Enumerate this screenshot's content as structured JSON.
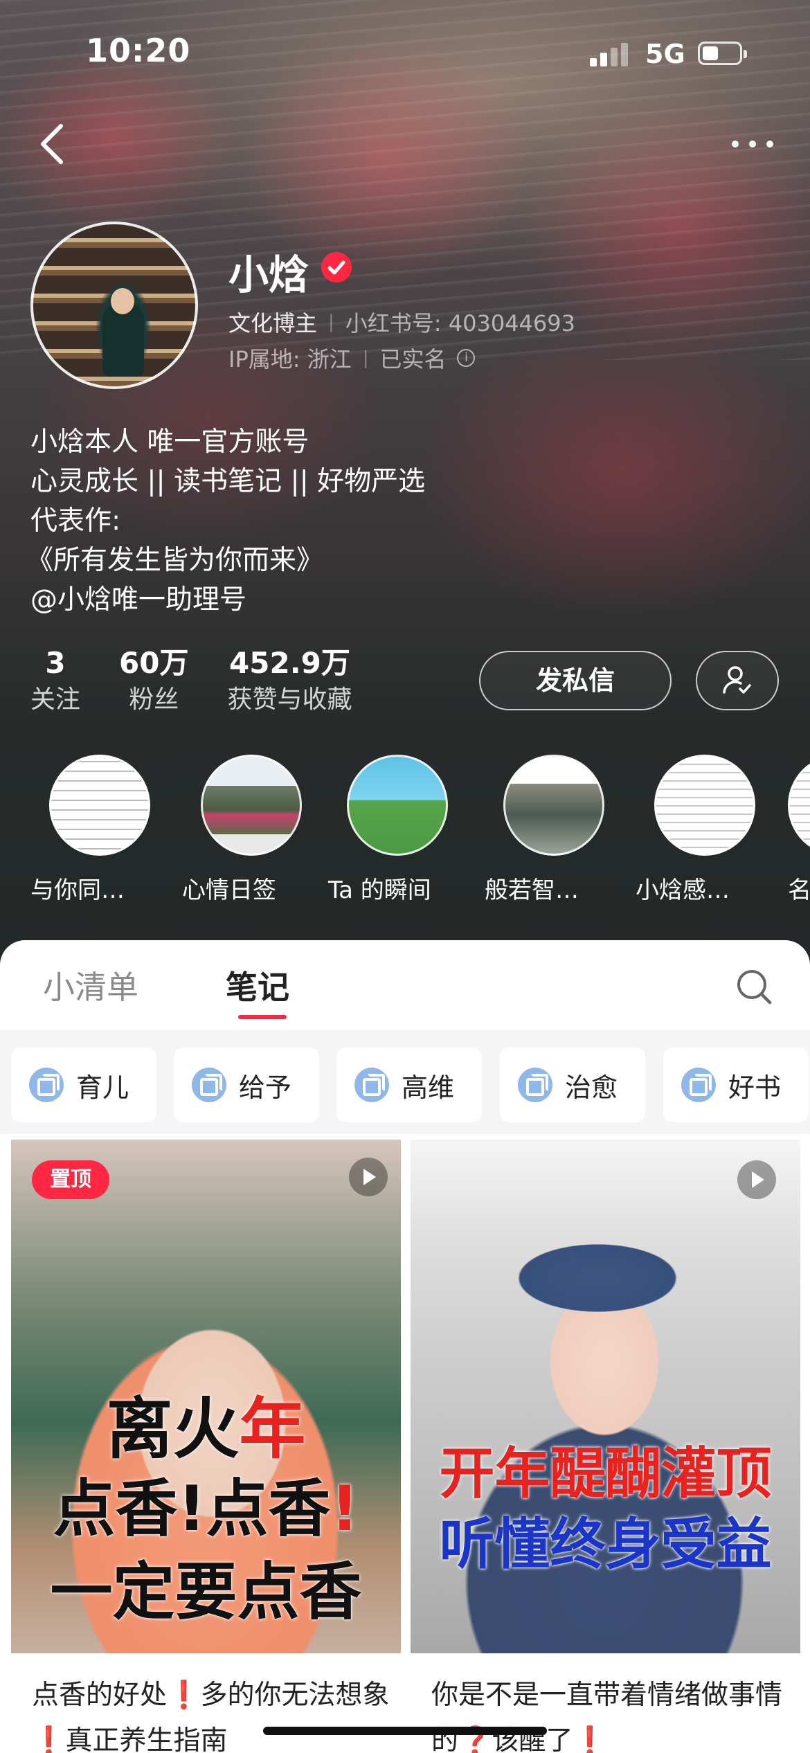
{
  "status_bar": {
    "time": "10:20",
    "network": "5G"
  },
  "profile": {
    "name": "小焓",
    "role": "文化博主",
    "id_label": "小红书号: 403044693",
    "ip_label": "IP属地: 浙江",
    "verified_label": "已实名",
    "bio": [
      "小焓本人 唯一官方账号",
      "心灵成长 || 读书笔记 || 好物严选",
      "代表作:",
      "《所有发生皆为你而来》",
      "@小焓唯一助理号"
    ]
  },
  "stats": [
    {
      "value": "3",
      "label": "关注"
    },
    {
      "value": "60万",
      "label": "粉丝"
    },
    {
      "value": "452.9万",
      "label": "获赞与收藏"
    }
  ],
  "actions": {
    "message": "发私信"
  },
  "highlights": [
    {
      "label": "与你同…"
    },
    {
      "label": "心情日签"
    },
    {
      "label": "Ta 的瞬间"
    },
    {
      "label": "般若智…"
    },
    {
      "label": "小焓感…"
    },
    {
      "label": "名"
    }
  ],
  "tabs": [
    {
      "label": "小清单",
      "active": false
    },
    {
      "label": "笔记",
      "active": true
    }
  ],
  "filters": [
    "育儿",
    "给予",
    "高维",
    "治愈",
    "好书"
  ],
  "cards": [
    {
      "badge": "置顶",
      "overlay_line1_a": "离火",
      "overlay_line1_b": "年",
      "overlay_line2_a": "点香!点香",
      "overlay_line2_b": "!",
      "overlay_line3": "一定要点香",
      "title": "点香的好处❗多的你无法想象❗真正养生指南"
    },
    {
      "overlay_line1": "开年醍醐灌顶",
      "overlay_line2": "听懂终身受益",
      "title": "你是不是一直带着情绪做事情的❓该醒了❗"
    }
  ],
  "colors": {
    "accent": "#ff2742",
    "header_bg": "#232828",
    "chip_icon": "#8fb7ea"
  }
}
